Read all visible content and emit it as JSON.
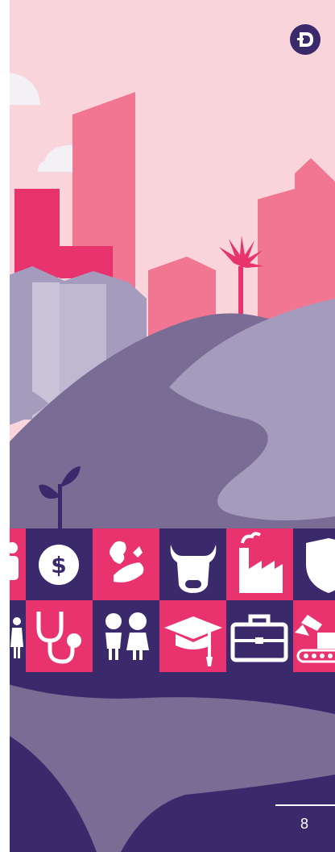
{
  "page": {
    "number": "8",
    "colors": {
      "sky": "#f9d4db",
      "pink": "#e8336f",
      "light_pink": "#f07692",
      "dark_purple": "#3a2a6b",
      "mid_purple": "#7a6d95",
      "light_purple": "#a59bbd",
      "cloud": "#f3f1f6"
    }
  },
  "logo": {
    "icon": "d-letter-logo-icon"
  },
  "icon_grid": {
    "rows": [
      [
        "person-icon",
        "dollar-coin-icon",
        "vegetables-icon",
        "cow-icon",
        "factory-icon",
        "shield-icon"
      ],
      [
        "family-icon",
        "stethoscope-icon",
        "children-icon",
        "graduation-icon",
        "briefcase-icon",
        "excavator-icon"
      ]
    ]
  }
}
